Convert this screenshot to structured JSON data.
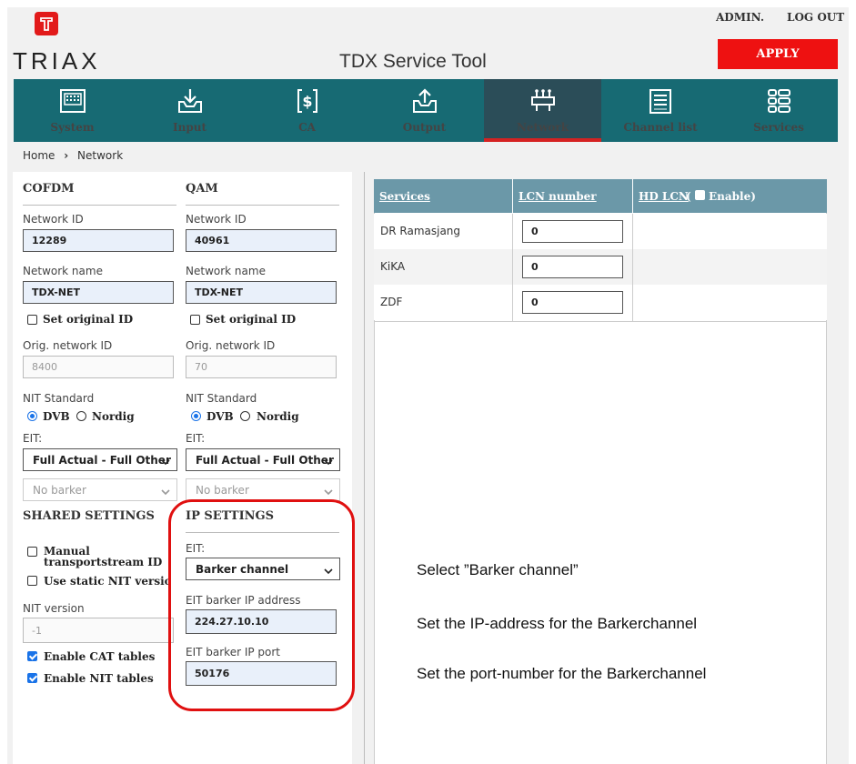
{
  "header": {
    "admin_label": "ADMIN.",
    "logout_label": "LOG OUT",
    "apply_label": "APPLY",
    "logo_text": "TRIAX",
    "title": "TDX Service Tool"
  },
  "colors": {
    "navbar": "#176a73",
    "nav_active": "#2b4d58",
    "accent_red": "#ee1111",
    "table_header": "#6b98a8",
    "checkbox_blue": "#1a73e8"
  },
  "nav": {
    "items": [
      {
        "label": "System",
        "icon": "keypad-icon"
      },
      {
        "label": "Input",
        "icon": "inbox-download-icon"
      },
      {
        "label": "CA",
        "icon": "dollar-icon"
      },
      {
        "label": "Output",
        "icon": "upload-icon"
      },
      {
        "label": "Network",
        "icon": "network-icon",
        "active": true
      },
      {
        "label": "Channel list",
        "icon": "list-icon"
      },
      {
        "label": "Services",
        "icon": "services-icon"
      }
    ]
  },
  "breadcrumb": {
    "home": "Home",
    "sep": "›",
    "current": "Network"
  },
  "cofdm": {
    "title": "COFDM",
    "network_id_label": "Network ID",
    "network_id": "12289",
    "network_name_label": "Network name",
    "network_name": "TDX-NET",
    "set_original_label": "Set original ID",
    "orig_id_label": "Orig. network ID",
    "orig_id": "8400",
    "nit_label": "NIT Standard",
    "nit_dvb": "DVB",
    "nit_nordig": "Nordig",
    "eit_label": "EIT:",
    "eit_value": "Full Actual - Full Other",
    "barker_value": "No barker"
  },
  "qam": {
    "title": "QAM",
    "network_id_label": "Network ID",
    "network_id": "40961",
    "network_name_label": "Network name",
    "network_name": "TDX-NET",
    "set_original_label": "Set original ID",
    "orig_id_label": "Orig. network ID",
    "orig_id": "70",
    "nit_label": "NIT Standard",
    "nit_dvb": "DVB",
    "nit_nordig": "Nordig",
    "eit_label": "EIT:",
    "eit_value": "Full Actual - Full Other",
    "barker_value": "No barker"
  },
  "shared": {
    "title": "SHARED SETTINGS",
    "manual_ts_label_1": "Manual",
    "manual_ts_label_2": "transportstream ID",
    "static_nit_label": "Use static NIT version",
    "nit_version_label": "NIT version",
    "nit_version": "-1",
    "cat_label": "Enable CAT tables",
    "nit_tables_label": "Enable NIT tables"
  },
  "ip": {
    "title": "IP SETTINGS",
    "eit_label": "EIT:",
    "eit_value": "Barker channel",
    "ip_label": "EIT barker IP address",
    "ip_value": "224.27.10.10",
    "port_label": "EIT barker IP port",
    "port_value": "50176"
  },
  "services_table": {
    "col_services": "Services",
    "col_lcn": "LCN number",
    "col_hd": "HD LCN",
    "hd_enable": "Enable)",
    "hd_paren": "(",
    "rows": [
      {
        "service": "DR Ramasjang",
        "lcn": "0"
      },
      {
        "service": "KiKA",
        "lcn": "0"
      },
      {
        "service": "ZDF",
        "lcn": "0"
      }
    ]
  },
  "annotations": [
    "Select ”Barker channel”",
    "Set the IP-address for the Barkerchannel",
    "Set the port-number for the Barkerchannel"
  ]
}
